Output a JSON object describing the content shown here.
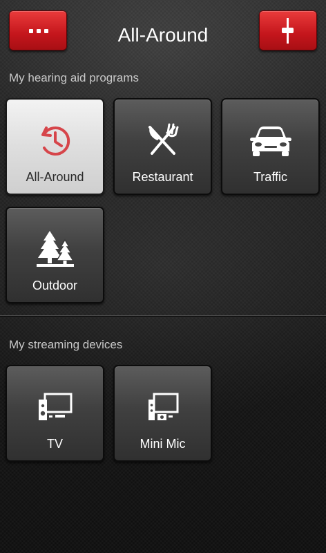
{
  "header": {
    "title": "All-Around",
    "menu_icon": "more-dots-icon",
    "settings_icon": "volume-slider-icon"
  },
  "programs": {
    "label": "My hearing aid programs",
    "items": [
      {
        "label": "All-Around",
        "icon": "all-around-icon",
        "active": true
      },
      {
        "label": "Restaurant",
        "icon": "fork-knife-icon",
        "active": false
      },
      {
        "label": "Traffic",
        "icon": "car-icon",
        "active": false
      },
      {
        "label": "Outdoor",
        "icon": "trees-icon",
        "active": false
      }
    ]
  },
  "streaming": {
    "label": "My streaming devices",
    "items": [
      {
        "label": "TV",
        "icon": "tv-streamer-icon"
      },
      {
        "label": "Mini Mic",
        "icon": "mini-mic-streamer-icon"
      }
    ]
  },
  "colors": {
    "accent": "#d11f26",
    "tile_active": "#e2e2e2",
    "tile_inactive": "#454545",
    "background": "#1a1a1a"
  }
}
